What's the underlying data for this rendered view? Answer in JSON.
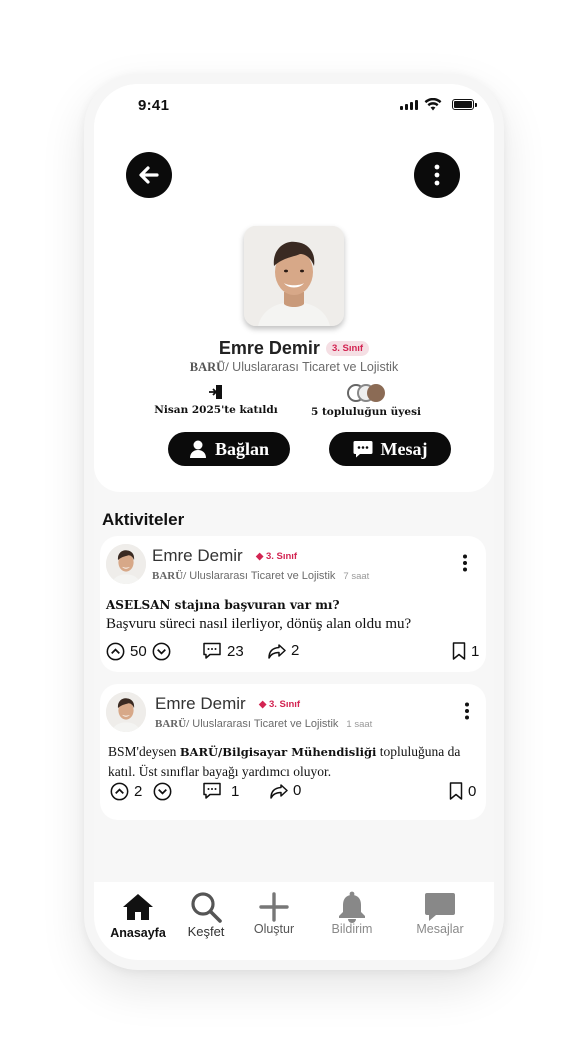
{
  "status_bar": {
    "time": "9:41"
  },
  "profile": {
    "name": "Emre Demir",
    "class_badge": "3. Sınıf",
    "dept_prefix": "BARÜ/",
    "dept_name": " Uluslararası Ticaret ve Lojistik",
    "joined": "Nisan 2025'te katıldı",
    "communities": "5 topluluğun üyesi",
    "connect_label": "Bağlan",
    "message_label": "Mesaj"
  },
  "section_title": "Aktiviteler",
  "posts": [
    {
      "author": "Emre Demir",
      "badge": "◆ 3. Sınıf",
      "dept_prefix": "BARÜ/",
      "dept_name": " Uluslararası Ticaret ve Lojistik",
      "time": "7 saat",
      "title": "ASELSAN stajına başvuran var mı?",
      "body": "Başvuru süreci nasıl ilerliyor, dönüş alan oldu mu?",
      "upvotes": "50",
      "comments": "23",
      "shares": "2",
      "saves": "1"
    },
    {
      "author": "Emre Demir",
      "badge": "◆ 3. Sınıf",
      "dept_prefix": "BARÜ/",
      "dept_name": " Uluslararası Ticaret ve Lojistik",
      "time": "1 saat",
      "body_pre": "BSM'deysen ",
      "body_bold": "BARÜ/Bilgisayar Mühendisliği",
      "body_post": " topluluğuna da katıl. Üst sınıflar bayağı yardımcı oluyor.",
      "upvotes": "2",
      "comments": "1",
      "shares": "0",
      "saves": "0"
    }
  ],
  "tabs": [
    {
      "label": "Anasayfa",
      "icon": "home-icon",
      "active": true
    },
    {
      "label": "Keşfet",
      "icon": "search-icon"
    },
    {
      "label": "Oluştur",
      "icon": "plus-icon"
    },
    {
      "label": "Bildirim",
      "icon": "bell-icon"
    },
    {
      "label": "Mesajlar",
      "icon": "chat-icon"
    }
  ],
  "colors": {
    "accent": "#d32452",
    "badge_bg": "#f5dfe4",
    "dark": "#0b0b0b",
    "inactive_tab": "#8a8a8a"
  }
}
